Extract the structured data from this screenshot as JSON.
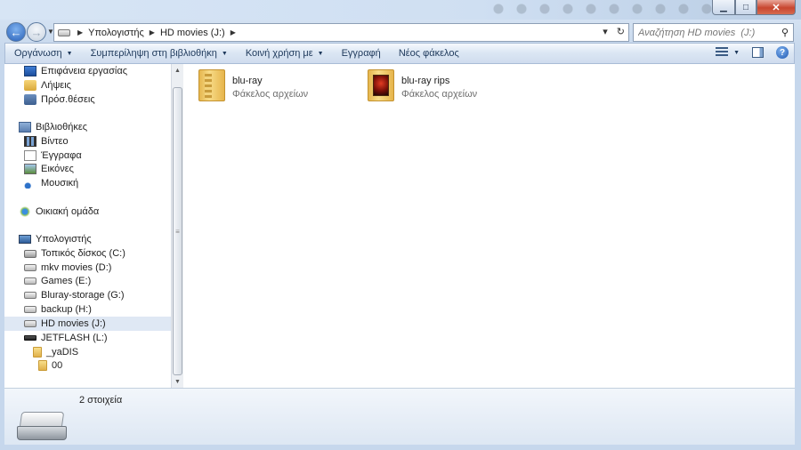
{
  "window": {
    "controls": {
      "minimize": "▁",
      "maximize": "□",
      "close": "✕"
    }
  },
  "nav": {
    "back_icon": "←",
    "forward_icon": "→"
  },
  "address": {
    "crumbs": [
      "Υπολογιστής",
      "HD movies  (J:)"
    ],
    "refresh_icon": "↻"
  },
  "search": {
    "placeholder": "Αναζήτηση HD movies  (J:)",
    "icon": "⚲"
  },
  "toolbar": {
    "organize": "Οργάνωση",
    "include_library": "Συμπερίληψη στη βιβλιοθήκη",
    "share_with": "Κοινή χρήση με",
    "burn": "Εγγραφή",
    "new_folder": "Νέος φάκελος",
    "help": "?"
  },
  "navpane": {
    "favorites": [
      "Επιφάνεια εργασίας",
      "Λήψεις",
      "Πρόσ.θέσεις"
    ],
    "libraries_header": "Βιβλιοθήκες",
    "libraries": [
      "Βίντεο",
      "Έγγραφα",
      "Εικόνες",
      "Μουσική"
    ],
    "homegroup": "Οικιακή ομάδα",
    "computer_header": "Υπολογιστής",
    "drives": [
      "Τοπικός δίσκος (C:)",
      "mkv movies (D:)",
      "Games (E:)",
      "Bluray-storage  (G:)",
      "backup (H:)",
      "HD movies  (J:)",
      "JETFLASH (L:)"
    ],
    "subfolders": [
      "_yaDIS",
      "00"
    ]
  },
  "content": {
    "items": [
      {
        "name": "blu-ray",
        "type": "Φάκελος αρχείων"
      },
      {
        "name": "blu-ray rips",
        "type": "Φάκελος αρχείων"
      }
    ]
  },
  "details": {
    "count": "2 στοιχεία"
  }
}
